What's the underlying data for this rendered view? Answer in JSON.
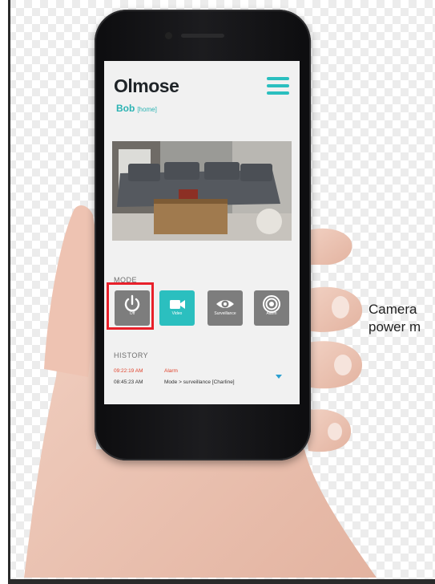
{
  "app": {
    "logo": "Olmose",
    "device_name": "Bob",
    "device_location": "[home]"
  },
  "mode": {
    "label": "MODE",
    "buttons": [
      {
        "label": "Off",
        "icon": "power-icon",
        "active": false,
        "highlighted": true
      },
      {
        "label": "Video",
        "icon": "video-camera-icon",
        "active": true
      },
      {
        "label": "Surveillance",
        "icon": "eye-icon",
        "active": false
      },
      {
        "label": "Alarm",
        "icon": "target-icon",
        "active": false
      }
    ]
  },
  "history": {
    "label": "HISTORY",
    "rows": [
      {
        "time": "09:22:19 AM",
        "event": "Alarm"
      },
      {
        "time": "08:45:23 AM",
        "event": "Mode > surveillance [Charline]"
      }
    ]
  },
  "caption": {
    "line1": "Camera",
    "line2": "power m"
  },
  "colors": {
    "accent": "#2bbfbf",
    "highlight": "#e8202a",
    "alarm": "#e0442e",
    "button_gray": "#7d7d7d"
  }
}
